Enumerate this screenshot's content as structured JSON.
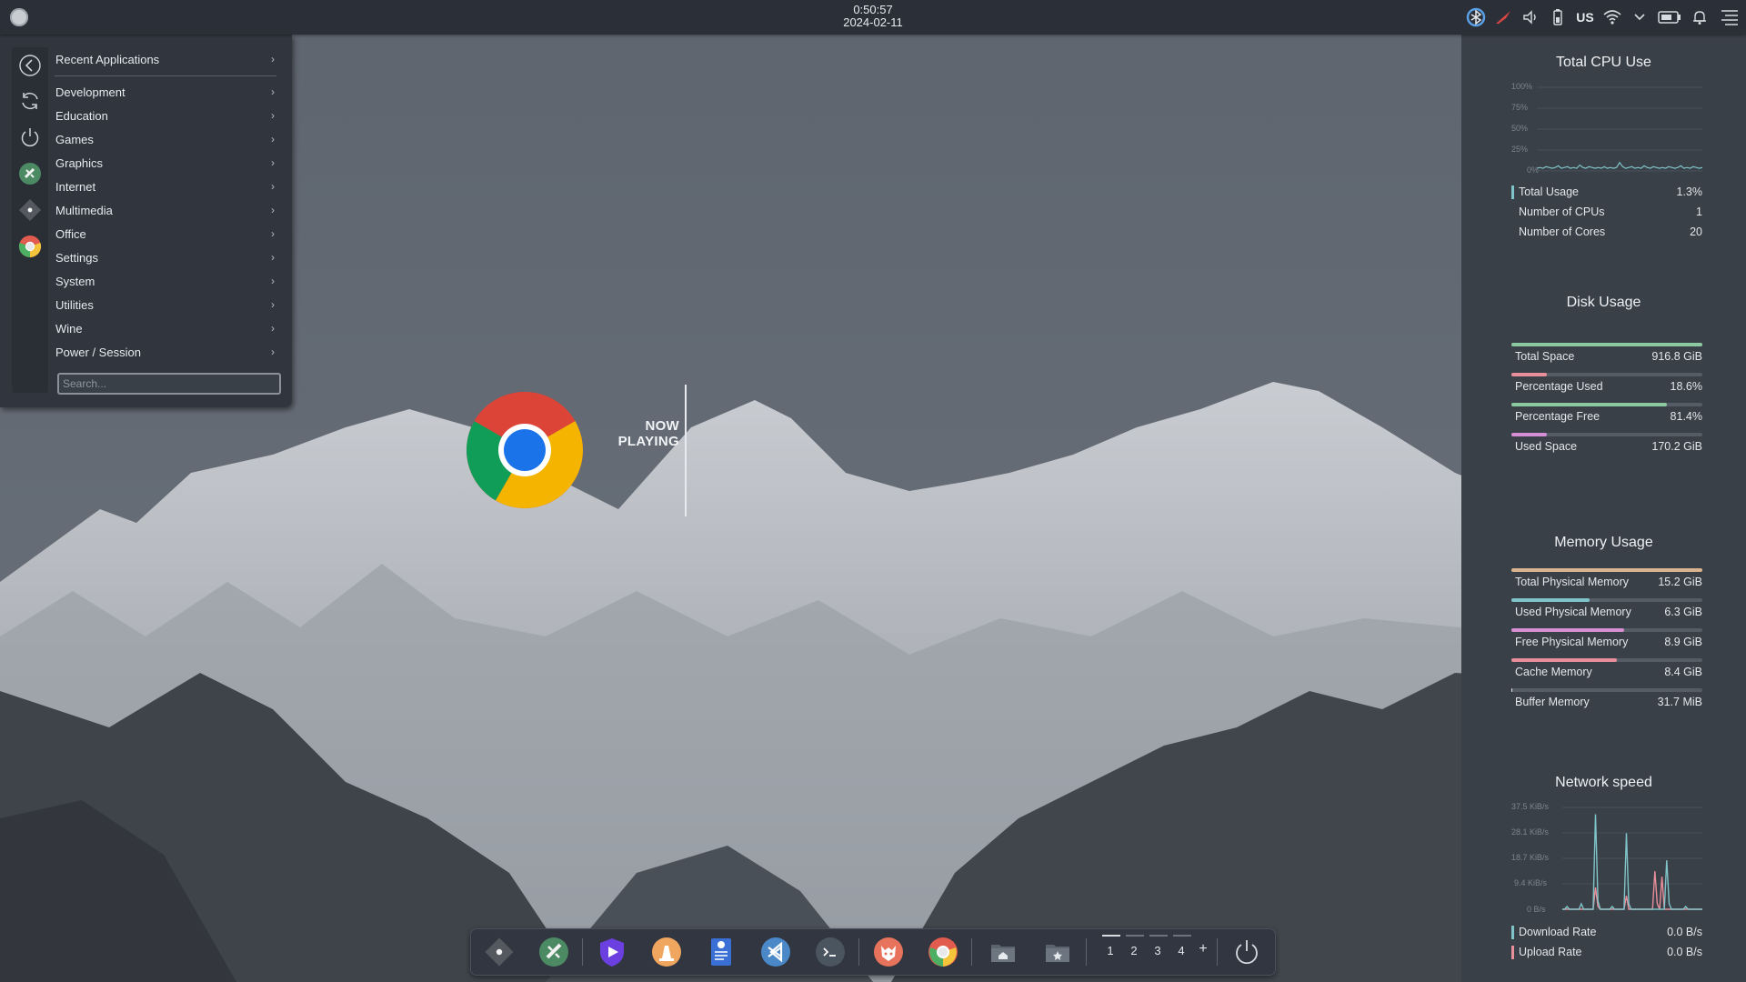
{
  "top_panel": {
    "time": "0:50:57",
    "date": "2024-02-11",
    "keyboard_layout": "US",
    "tray_icons": [
      "bluetooth-icon",
      "redshift-icon",
      "volume-icon",
      "battery-device-icon",
      "wifi-icon",
      "chevron-down-icon",
      "battery-icon",
      "notifications-icon",
      "menu-icon"
    ]
  },
  "app_menu": {
    "recent_label": "Recent Applications",
    "categories": [
      "Development",
      "Education",
      "Games",
      "Graphics",
      "Internet",
      "Multimedia",
      "Office",
      "Settings",
      "System",
      "Utilities",
      "Wine",
      "Power / Session"
    ],
    "search_placeholder": "Search...",
    "side_icons": [
      "back-icon",
      "refresh-icon",
      "power-icon",
      "app-green-icon",
      "app-grey-icon",
      "chrome-icon"
    ]
  },
  "now_playing": {
    "line1": "NOW",
    "line2": "PLAYING"
  },
  "sidebar": {
    "cpu": {
      "title": "Total CPU Use",
      "axis": [
        "100%",
        "75%",
        "50%",
        "25%",
        "0%"
      ],
      "rows": [
        {
          "label": "Total Usage",
          "value": "1.3%"
        },
        {
          "label": "Number of CPUs",
          "value": "1"
        },
        {
          "label": "Number of Cores",
          "value": "20"
        }
      ],
      "history": [
        1,
        2,
        1,
        3,
        2,
        1,
        2,
        4,
        1,
        2,
        3,
        1,
        2,
        1,
        5,
        2,
        1,
        3,
        2,
        1,
        2,
        1,
        3,
        1,
        2,
        1,
        2,
        8,
        3,
        1,
        2,
        3,
        1,
        2,
        1,
        4,
        2,
        1,
        3,
        2,
        1,
        2,
        1,
        3,
        2,
        1,
        2,
        4,
        1,
        2,
        1,
        3,
        2,
        1,
        2
      ]
    },
    "disk": {
      "title": "Disk Usage",
      "rows": [
        {
          "label": "Total Space",
          "value": "916.8 GiB",
          "fill": 1.0,
          "color": "#8cc9a0"
        },
        {
          "label": "Percentage Used",
          "value": "18.6%",
          "fill": 0.186,
          "color": "#e88f9b"
        },
        {
          "label": "Percentage Free",
          "value": "81.4%",
          "fill": 0.814,
          "color": "#8cc9a0"
        },
        {
          "label": "Used Space",
          "value": "170.2 GiB",
          "fill": 0.186,
          "color": "#d68fd4"
        }
      ]
    },
    "memory": {
      "title": "Memory Usage",
      "rows": [
        {
          "label": "Total Physical Memory",
          "value": "15.2 GiB",
          "fill": 1.0,
          "color": "#d9b48f"
        },
        {
          "label": "Used Physical Memory",
          "value": "6.3 GiB",
          "fill": 0.41,
          "color": "#7fc4c8"
        },
        {
          "label": "Free Physical Memory",
          "value": "8.9 GiB",
          "fill": 0.59,
          "color": "#d68fd4"
        },
        {
          "label": "Cache Memory",
          "value": "8.4 GiB",
          "fill": 0.55,
          "color": "#e88f9b"
        },
        {
          "label": "Buffer Memory",
          "value": "31.7 MiB",
          "fill": 0.003,
          "color": "#e3e6ea"
        }
      ]
    },
    "network": {
      "title": "Network speed",
      "axis": [
        "37.5 KiB/s",
        "28.1 KiB/s",
        "18.7 KiB/s",
        "9.4 KiB/s",
        "0 B/s"
      ],
      "rows": [
        {
          "label": "Download Rate",
          "value": "0.0 B/s",
          "color": "#7fc4c8"
        },
        {
          "label": "Upload Rate",
          "value": "0.0 B/s",
          "color": "#e88f9b"
        }
      ],
      "download_history": [
        0,
        0,
        1,
        0,
        0,
        0,
        0,
        0,
        2,
        0,
        0,
        0,
        0,
        0,
        35,
        3,
        0,
        0,
        0,
        0,
        0,
        1,
        0,
        0,
        0,
        0,
        0,
        28,
        2,
        0,
        0,
        0,
        0,
        0,
        0,
        0,
        0,
        0,
        0,
        0,
        0,
        0,
        0,
        0,
        18,
        2,
        0,
        0,
        0,
        0,
        0,
        0,
        1,
        0,
        0,
        0,
        0,
        0,
        0,
        0
      ],
      "upload_history": [
        0,
        0,
        0,
        0,
        0,
        0,
        0,
        0,
        0,
        0,
        0,
        0,
        0,
        0,
        8,
        1,
        0,
        0,
        0,
        0,
        0,
        0,
        0,
        0,
        0,
        0,
        0,
        5,
        0,
        0,
        0,
        0,
        0,
        0,
        0,
        0,
        0,
        0,
        0,
        14,
        2,
        0,
        12,
        0,
        0,
        0,
        0,
        0,
        0,
        0,
        0,
        0,
        0,
        0,
        0,
        0,
        0,
        0,
        0,
        0
      ]
    }
  },
  "dock": {
    "apps": [
      "app-grey-icon",
      "app-green-icon",
      "shield-player-icon",
      "vlc-icon",
      "text-editor-icon",
      "vscode-icon",
      "terminal-icon",
      "firefox-icon",
      "chrome-icon"
    ],
    "folders": [
      "home-folder-icon",
      "starred-folder-icon"
    ],
    "workspaces": [
      "1",
      "2",
      "3",
      "4"
    ],
    "add_workspace": "+"
  },
  "colors": {
    "panel": "#2b3038",
    "sidebar": "#3a4048",
    "accent": "#6fb2c8"
  }
}
